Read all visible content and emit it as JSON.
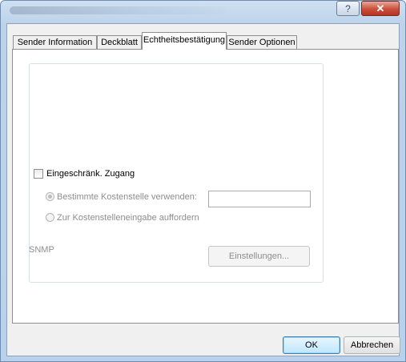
{
  "window": {
    "help_symbol": "?",
    "close_symbol": "✕"
  },
  "tabs": [
    {
      "label": "Sender Information"
    },
    {
      "label": "Deckblatt"
    },
    {
      "label": "Echtheitsbestätigung"
    },
    {
      "label": "Sender Optionen"
    }
  ],
  "restricted_access": {
    "label": "Eingeschränk. Zugang",
    "checked": false
  },
  "options": {
    "specific_cost_center_label": "Bestimmte Kostenstelle verwenden:",
    "specific_cost_center_value": "",
    "prompt_cost_center_label": "Zur Kostenstelleneingabe auffordern"
  },
  "snmp": {
    "label": "SNMP",
    "settings_button": "Einstellungen..."
  },
  "footer": {
    "ok_button": "OK",
    "cancel_button": "Abbrechen"
  }
}
